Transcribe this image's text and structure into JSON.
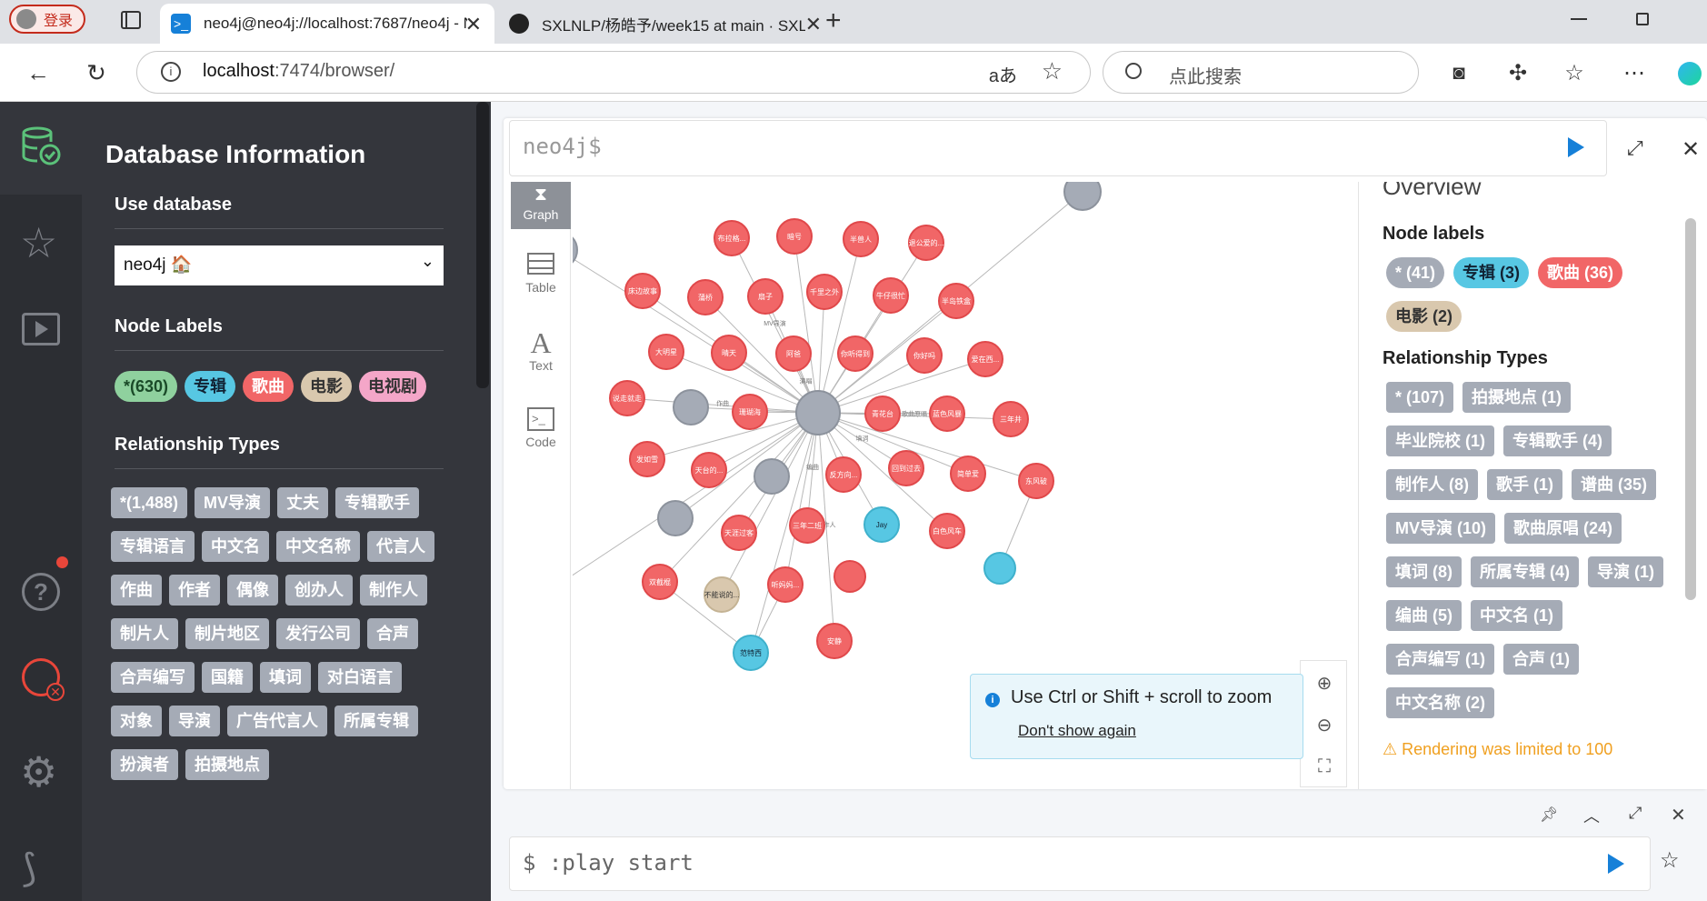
{
  "browser": {
    "profile_label": "登录",
    "tabs": [
      {
        "title": "neo4j@neo4j://localhost:7687/neo4j - Neo4j Browser",
        "active": true
      },
      {
        "title": "SXLNLP/杨皓予/week15 at main · SXLNLP",
        "active": false
      }
    ],
    "url_host": "localhost",
    "url_rest": ":7474/browser/",
    "search_placeholder": "点此搜索"
  },
  "drawer": {
    "title": "Database Information",
    "use_db_heading": "Use database",
    "db_select": "neo4j 🏠",
    "node_labels_heading": "Node Labels",
    "node_labels": [
      {
        "label": "*(630)",
        "color": "#8fd19e",
        "text": "#1a4a28"
      },
      {
        "label": "专辑",
        "color": "#57c7e3",
        "text": "#123"
      },
      {
        "label": "歌曲",
        "color": "#f16667",
        "text": "#fff"
      },
      {
        "label": "电影",
        "color": "#d9c8ae",
        "text": "#333"
      },
      {
        "label": "电视剧",
        "color": "#f4a6c8",
        "text": "#333"
      }
    ],
    "rel_types_heading": "Relationship Types",
    "rel_types": [
      "*(1,488)",
      "MV导演",
      "丈夫",
      "专辑歌手",
      "专辑语言",
      "中文名",
      "中文名称",
      "代言人",
      "作曲",
      "作者",
      "偶像",
      "创办人",
      "制作人",
      "制片人",
      "制片地区",
      "发行公司",
      "合声",
      "合声编写",
      "国籍",
      "填词",
      "对白语言",
      "对象",
      "导演",
      "广告代言人",
      "所属专辑",
      "扮演者",
      "拍摄地点"
    ]
  },
  "editor": {
    "prompt": "neo4j$"
  },
  "views": [
    {
      "name": "Graph",
      "icon": "graph-icon"
    },
    {
      "name": "Table",
      "icon": "table-icon"
    },
    {
      "name": "Text",
      "icon": "text-icon"
    },
    {
      "name": "Code",
      "icon": "code-icon"
    }
  ],
  "overview": {
    "title": "Overview",
    "node_labels_heading": "Node labels",
    "node_labels": [
      {
        "label": "* (41)",
        "color": "#a5abb6",
        "text": "#fff"
      },
      {
        "label": "专辑 (3)",
        "color": "#57c7e3",
        "text": "#123"
      },
      {
        "label": "歌曲 (36)",
        "color": "#f16667",
        "text": "#fff"
      },
      {
        "label": "电影 (2)",
        "color": "#d9c8ae",
        "text": "#333"
      }
    ],
    "rel_types_heading": "Relationship Types",
    "rel_types": [
      "* (107)",
      "拍摄地点 (1)",
      "毕业院校 (1)",
      "专辑歌手 (4)",
      "制作人 (8)",
      "歌手 (1)",
      "谱曲 (35)",
      "MV导演 (10)",
      "歌曲原唱 (24)",
      "填词 (8)",
      "所属专辑 (4)",
      "导演 (1)",
      "编曲 (5)",
      "中文名 (1)",
      "合声编写 (1)",
      "合声 (1)",
      "中文名称 (2)"
    ],
    "warning": "⚠ Rendering was limited to 100"
  },
  "toast": {
    "message": "Use Ctrl or Shift + scroll to zoom",
    "dismiss": "Don't show again"
  },
  "cmdbar": {
    "text": "$ :play start"
  },
  "graph": {
    "center_node": "",
    "song_nodes": [
      "布拉格...",
      "暗号",
      "半兽人",
      "退公爱的...",
      "床边故事",
      "蒲桥",
      "扇子",
      "千里之外",
      "牛仔很忙",
      "半岛铁盒",
      "大明星",
      "晴天",
      "阿爸",
      "你听得到",
      "你好吗",
      "爱在西...",
      "说走就走",
      "珊瑚海",
      "青花台",
      "蓝色风暴",
      "三年井",
      "发如雪",
      "天台的...",
      "反方向...",
      "回到过去",
      "简单爱",
      "东风破",
      "天涯过客",
      "三年二班",
      "白色风车",
      "双截棍",
      "听妈妈...",
      "安静"
    ],
    "album_nodes": [
      "Jay",
      "范特西"
    ],
    "movie_nodes": [
      "不能说的..."
    ],
    "edge_labels": [
      "MV导演",
      "谱曲",
      "所属专辑",
      "演唱",
      "作曲",
      "歌曲原唱",
      "填词",
      "编曲",
      "制作人"
    ]
  }
}
